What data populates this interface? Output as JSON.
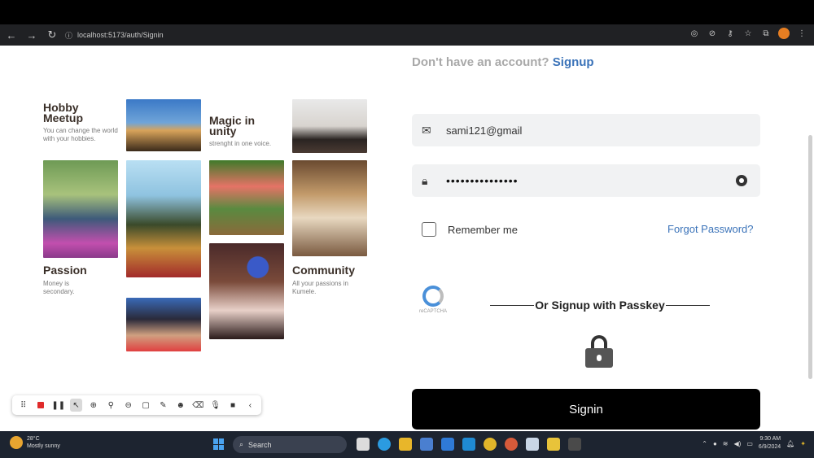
{
  "browser": {
    "url": "localhost:5173/auth/Signin",
    "icons": [
      "back-icon",
      "forward-icon",
      "reload-icon",
      "site-info-icon",
      "location-icon",
      "eye-off-icon",
      "key-icon",
      "star-icon",
      "extensions-icon",
      "profile-icon",
      "menu-icon"
    ]
  },
  "page": {
    "signup_prompt": "Don't have an account?",
    "signup_link": "Signup",
    "email_value": "sami121@gmail",
    "password_value": "•••••••••••••••",
    "remember_label": "Remember me",
    "forgot_label": "Forgot Password?",
    "passkey_label": "Or Signup with Passkey",
    "recaptcha_label": "reCAPTCHA",
    "signin_label": "Signin"
  },
  "collage": {
    "hobby": {
      "title": "Hobby Meetup",
      "subtitle": "You can change the world with your hobbies."
    },
    "magic": {
      "title": "Magic in unity",
      "subtitle": "strenght in one voice."
    },
    "passion": {
      "title": "Passion",
      "subtitle": "Money is secondary."
    },
    "community": {
      "title": "Community",
      "subtitle": "All your passions in Kumele."
    }
  },
  "taskbar": {
    "weather_temp": "28°C",
    "weather_desc": "Mostly sunny",
    "search_placeholder": "Search",
    "time": "9:30 AM",
    "date": "6/9/2024"
  },
  "colors": {
    "accent": "#3b73b9",
    "signin_bg": "#000000",
    "field_bg": "#f1f2f3"
  }
}
